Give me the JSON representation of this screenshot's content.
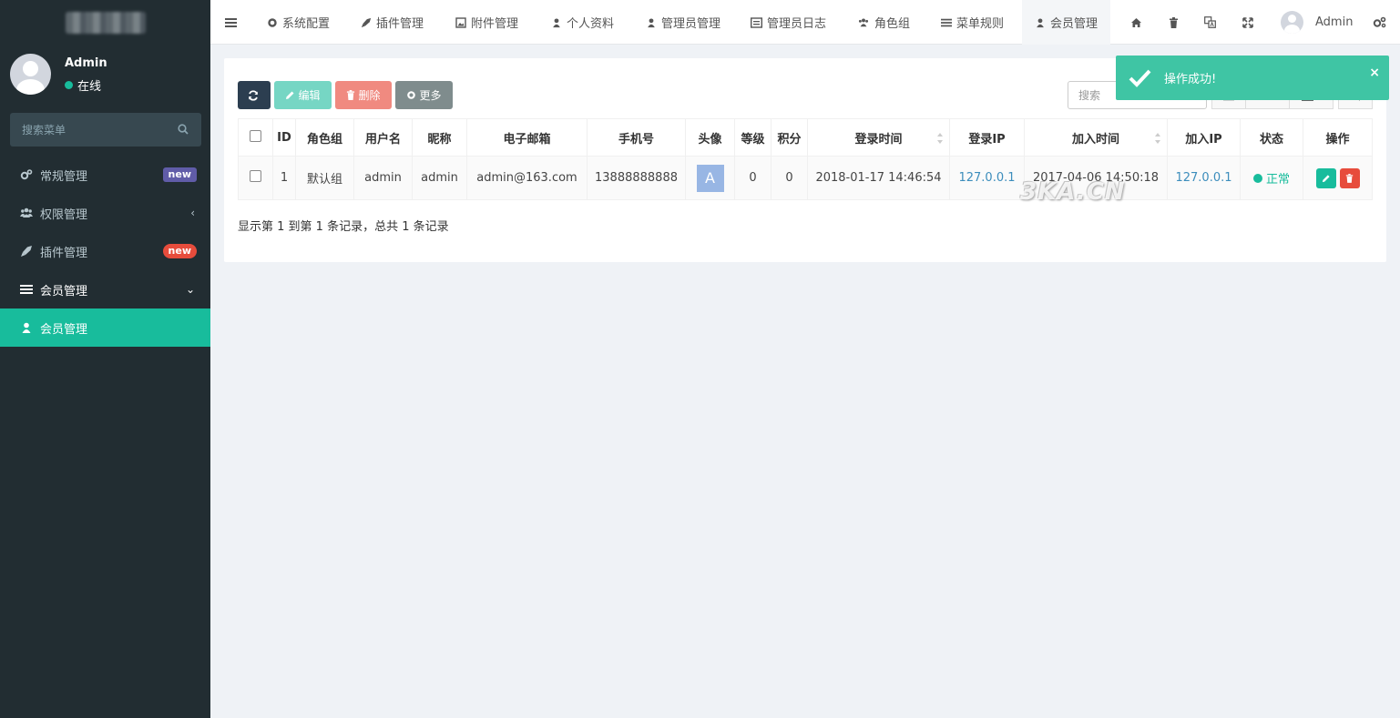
{
  "sidebar": {
    "user": {
      "name": "Admin",
      "status": "在线"
    },
    "search": {
      "placeholder": "搜索菜单"
    },
    "items": [
      {
        "label": "常规管理",
        "icon": "cogs-icon",
        "badge": "new"
      },
      {
        "label": "权限管理",
        "icon": "group-icon",
        "chevron": "‹"
      },
      {
        "label": "插件管理",
        "icon": "rocket-icon",
        "badge": "new"
      },
      {
        "label": "会员管理",
        "icon": "list-icon",
        "chevron": "⌄"
      },
      {
        "label": "会员管理",
        "icon": "user-icon"
      }
    ]
  },
  "topnav": {
    "tabs": [
      "系统配置",
      "插件管理",
      "附件管理",
      "个人资料",
      "管理员管理",
      "管理员日志",
      "角色组",
      "菜单规则",
      "会员管理"
    ],
    "admin_name": "Admin"
  },
  "toolbar": {
    "edit": "编辑",
    "delete": "删除",
    "more": "更多",
    "search_placeholder": "搜索"
  },
  "table": {
    "columns": [
      "ID",
      "角色组",
      "用户名",
      "昵称",
      "电子邮箱",
      "手机号",
      "头像",
      "等级",
      "积分",
      "登录时间",
      "登录IP",
      "加入时间",
      "加入IP",
      "状态",
      "操作"
    ],
    "rows": [
      {
        "id": "1",
        "group": "默认组",
        "username": "admin",
        "nickname": "admin",
        "email": "admin@163.com",
        "mobile": "13888888888",
        "avatar": "A",
        "level": "0",
        "score": "0",
        "login_time": "2018-01-17 14:46:54",
        "login_ip": "127.0.0.1",
        "join_time": "2017-04-06 14:50:18",
        "join_ip": "127.0.0.1",
        "status": "正常"
      }
    ]
  },
  "pagination": {
    "info": "显示第 1 到第 1 条记录，总共 1 条记录"
  },
  "toast": {
    "message": "操作成功!",
    "close": "×"
  },
  "watermark": "3KA.CN",
  "colors": {
    "sidebar_bg": "#222d32",
    "accent": "#18bc9c",
    "danger": "#e74c3c",
    "link": "#3c8dbc"
  }
}
